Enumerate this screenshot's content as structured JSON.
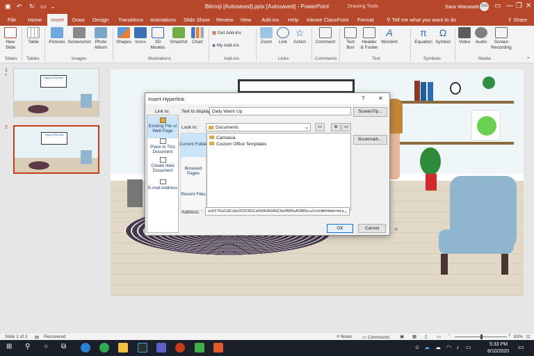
{
  "titlebar": {
    "document": "Bitmoji [Autosaved].pptx [Autosaved] - PowerPoint",
    "context_tab": "Drawing Tools",
    "tell_me": "Tell me what you want to do",
    "user": "Sara Wanasek",
    "initials": "SW"
  },
  "tabs": [
    "File",
    "Home",
    "Insert",
    "Draw",
    "Design",
    "Transitions",
    "Animations",
    "Slide Show",
    "Review",
    "View",
    "Add-ins",
    "Help",
    "Inknoe ClassPoint",
    "Format"
  ],
  "share": "Share",
  "ribbon": {
    "slides": {
      "new": "New\nSlide",
      "layout_group": "Slides"
    },
    "tables": {
      "table": "Table",
      "group": "Tables"
    },
    "images": {
      "pictures": "Pictures",
      "screenshot": "Screenshot",
      "album": "Photo\nAlbum",
      "group": "Images"
    },
    "illustrations": {
      "shapes": "Shapes",
      "icons": "Icons",
      "models": "3D\nModels",
      "smartart": "SmartArt",
      "chart": "Chart",
      "group": "Illustrations"
    },
    "addins": {
      "get": "Get Add-ins",
      "my": "My Add-ins",
      "group": "Add-ins"
    },
    "links": {
      "zoom": "Zoom",
      "link": "Link",
      "action": "Action",
      "group": "Links"
    },
    "comments": {
      "comment": "Comment",
      "group": "Comments"
    },
    "text": {
      "textbox": "Text\nBox",
      "header": "Header\n& Footer",
      "wordart": "WordArt",
      "group": "Text"
    },
    "symbols": {
      "equation": "Equation",
      "symbol": "Symbol",
      "group": "Symbols"
    },
    "media": {
      "video": "Video",
      "audio": "Audio",
      "screen": "Screen\nRecording",
      "group": "Media"
    }
  },
  "slides_pane": [
    {
      "num": "1",
      "mark": "*",
      "board": "Happy Monday!"
    },
    {
      "num": "2",
      "mark": "",
      "board": "Happy Monday!"
    }
  ],
  "dialog": {
    "title": "Insert Hyperlink",
    "help": "?",
    "close": "✕",
    "link_to": "Link to:",
    "link_options": [
      "Existing File or Web Page",
      "Place in This Document",
      "Create New Document",
      "E-mail Address"
    ],
    "text_label": "Text to display:",
    "text_value": "Daily Warm Up",
    "screentip": "ScreenTip...",
    "look_in_label": "Look in:",
    "look_in_value": "Documents",
    "side_items": [
      "Current Folder",
      "Browsed Pages",
      "Recent Files"
    ],
    "files": [
      "Camtasia",
      "Custom Office Templates"
    ],
    "bookmark": "Bookmark...",
    "address_label": "Address:",
    "address_value": "s/d/17GsCdCcbcOOC9DCeNXiKAGtNZ3w9fM0sASM0u-uVc/edit#slide=id.p",
    "ok": "OK",
    "cancel": "Cancel"
  },
  "status": {
    "slide": "Slide 2 of 2",
    "recovered": "Recovered",
    "notes": "Notes",
    "comments": "Comments",
    "zoom": "83%"
  },
  "taskbar": {
    "time": "5:33 PM",
    "date": "8/10/2020"
  },
  "colors": {
    "accent": "#b7472a",
    "dialog_bg": "#f0f0f0",
    "selected": "#cce4f7"
  }
}
